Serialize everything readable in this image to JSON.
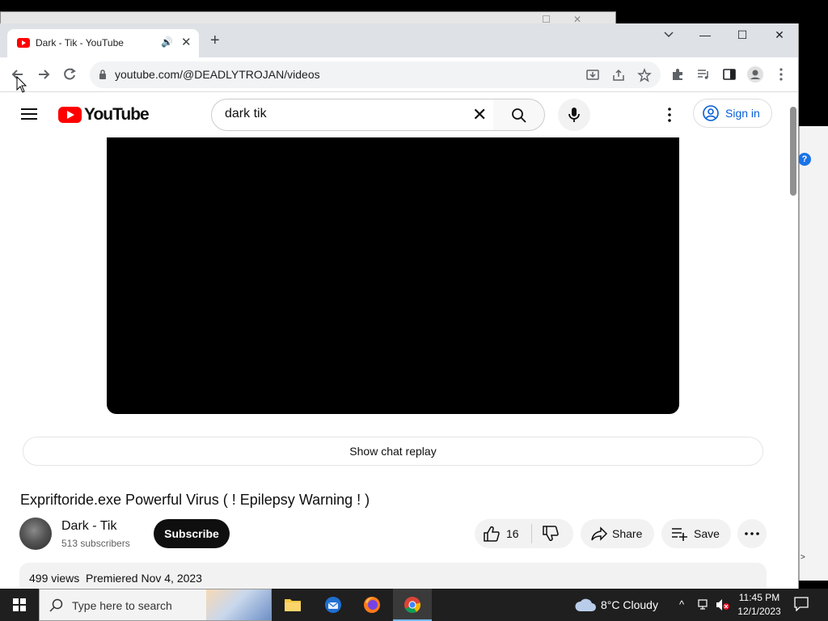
{
  "browser": {
    "tab_title": "Dark - Tik - YouTube",
    "url": "youtube.com/@DEADLYTROJAN/videos",
    "window_controls": [
      "—",
      "☐",
      "✕"
    ],
    "new_tab_symbol": "+"
  },
  "youtube": {
    "logo_text": "YouTube",
    "search_value": "dark tik",
    "signin_label": "Sign in",
    "chat_replay_label": "Show chat replay",
    "video_title": "Expriftoride.exe Powerful Virus ( ! Epilepsy Warning ! )",
    "channel_name": "Dark - Tik",
    "subscribers": "513 subscribers",
    "subscribe_label": "Subscribe",
    "likes": "16",
    "share_label": "Share",
    "save_label": "Save",
    "views": "499 views",
    "premiere_date": "Premiered Nov 4, 2023"
  },
  "taskbar": {
    "search_placeholder": "Type here to search",
    "weather": "8°C  Cloudy",
    "time": "11:45 PM",
    "date": "12/1/2023"
  },
  "colors": {
    "youtube_red": "#ff0000",
    "link_blue": "#065fd4",
    "taskbar_bg": "#1f1f1f",
    "tabstrip_bg": "#dee1e6"
  },
  "icons": [
    "back-icon",
    "forward-icon",
    "reload-icon",
    "lock-icon",
    "install-icon",
    "share-icon",
    "star-icon",
    "extensions-icon",
    "media-icon",
    "sidepanel-icon",
    "profile-icon",
    "menu-icon",
    "search-icon",
    "mic-icon",
    "like-icon",
    "dislike-icon",
    "save-icon",
    "more-icon",
    "windows-start-icon",
    "file-explorer-icon",
    "thunderbird-icon",
    "firefox-icon",
    "chrome-icon"
  ]
}
